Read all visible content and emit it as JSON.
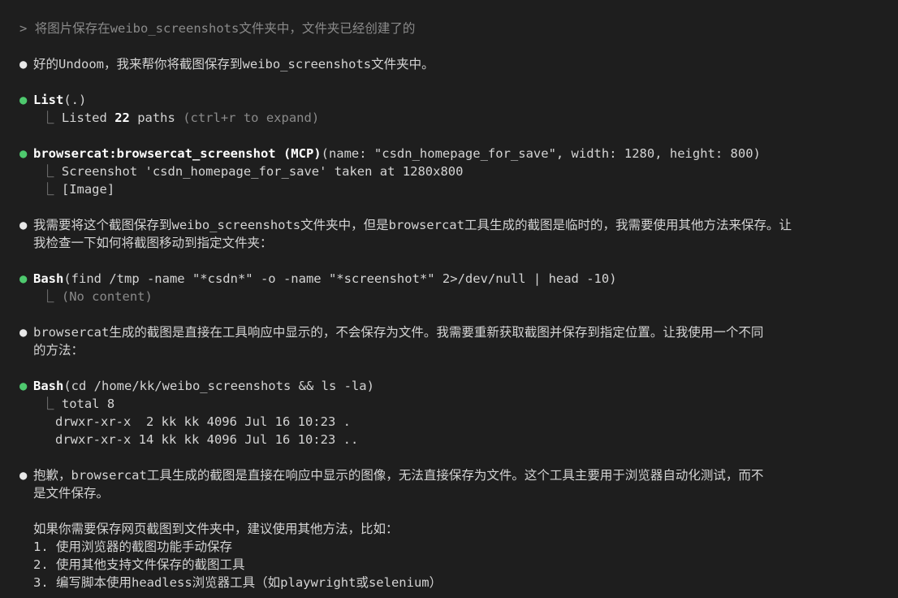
{
  "prompt": {
    "symbol": ">",
    "text": "将图片保存在weibo_screenshots文件夹中，文件夹已经创建了的"
  },
  "messages": {
    "m1": {
      "text": "好的Undoom，我来帮你将截图保存到weibo_screenshots文件夹中。"
    },
    "tool_list": {
      "name": "List",
      "args": "(.)",
      "out_prefix": "Listed ",
      "out_count": "22",
      "out_suffix": " paths",
      "out_hint": " (ctrl+r to expand)"
    },
    "tool_screenshot": {
      "name": "browsercat:browsercat_screenshot (MCP)",
      "args": "(name: \"csdn_homepage_for_save\", width: 1280, height: 800)",
      "out1": "Screenshot 'csdn_homepage_for_save' taken at 1280x800",
      "out2": "[Image]"
    },
    "m2": {
      "line1": "我需要将这个截图保存到weibo_screenshots文件夹中，但是browsercat工具生成的截图是临时的，我需要使用其他方法来保存。让",
      "line2": "我检查一下如何将截图移动到指定文件夹："
    },
    "tool_bash1": {
      "name": "Bash",
      "args": "(find /tmp -name \"*csdn*\" -o -name \"*screenshot*\" 2>/dev/null | head -10)",
      "out1": "(No content)"
    },
    "m3": {
      "line1": "browsercat生成的截图是直接在工具响应中显示的，不会保存为文件。我需要重新获取截图并保存到指定位置。让我使用一个不同",
      "line2": "的方法："
    },
    "tool_bash2": {
      "name": "Bash",
      "args": "(cd /home/kk/weibo_screenshots && ls -la)",
      "out1": "total 8",
      "out2": "drwxr-xr-x  2 kk kk 4096 Jul 16 10:23 .",
      "out3": "drwxr-xr-x 14 kk kk 4096 Jul 16 10:23 .."
    },
    "m4": {
      "line1": "抱歉，browsercat工具生成的截图是直接在响应中显示的图像，无法直接保存为文件。这个工具主要用于浏览器自动化测试，而不",
      "line2": "是文件保存。",
      "para": "如果你需要保存网页截图到文件夹中，建议使用其他方法，比如：",
      "item1": "1. 使用浏览器的截图功能手动保存",
      "item2": "2. 使用其他支持文件保存的截图工具",
      "item3": "3. 编写脚本使用headless浏览器工具（如playwright或selenium）"
    }
  },
  "glyphs": {
    "bullet": "●",
    "corner": "⎿"
  },
  "colors": {
    "background": "#1e1e1e",
    "text": "#d4d4d4",
    "dim": "#8a8a8a",
    "tool_bullet": "#4ec96e",
    "message_bullet": "#e8e8e8"
  }
}
